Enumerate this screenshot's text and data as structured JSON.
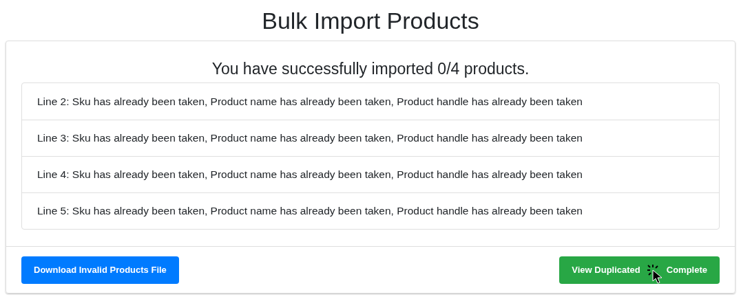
{
  "page": {
    "title": "Bulk Import Products"
  },
  "result": {
    "heading": "You have successfully imported 0/4 products.",
    "errors": [
      "Line 2: Sku has already been taken, Product name has already been taken, Product handle has already been taken",
      "Line 3: Sku has already been taken, Product name has already been taken, Product handle has already been taken",
      "Line 4: Sku has already been taken, Product name has already been taken, Product handle has already been taken",
      "Line 5: Sku has already been taken, Product name has already been taken, Product handle has already been taken"
    ]
  },
  "footer": {
    "buttons": [
      {
        "label": "Download Invalid Products File",
        "kind": "primary"
      },
      {
        "label": "View Duplicated",
        "kind": "success"
      },
      {
        "label": "Complete",
        "kind": "success"
      }
    ]
  }
}
